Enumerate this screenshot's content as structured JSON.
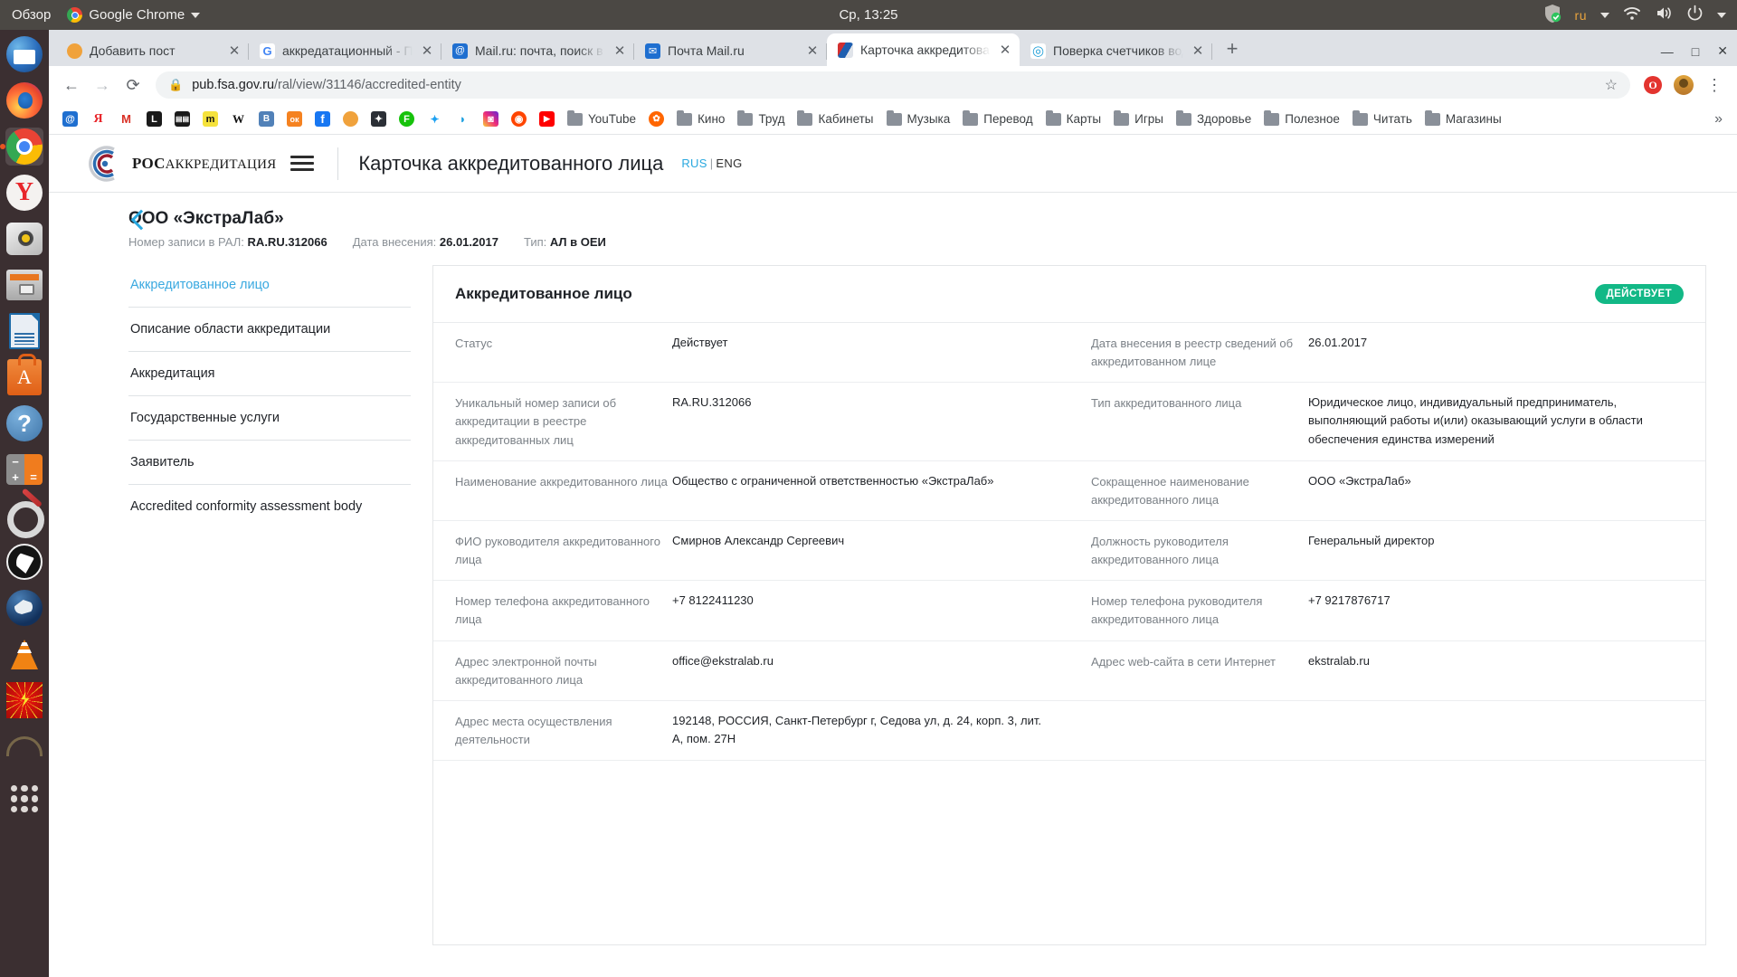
{
  "os_panel": {
    "activities": "Обзор",
    "app_menu": "Google Chrome",
    "clock": "Ср, 13:25",
    "tray": {
      "shield_icon": "shield-check-icon",
      "language": "ru",
      "wifi_icon": "wifi-icon",
      "volume_icon": "volume-icon",
      "power_icon": "power-icon"
    }
  },
  "dock": {
    "items": [
      {
        "name": "thunderbird",
        "label": "Thunderbird"
      },
      {
        "name": "firefox",
        "label": "Firefox"
      },
      {
        "name": "google-chrome",
        "label": "Google Chrome"
      },
      {
        "name": "yandex-browser",
        "label": "Yandex Browser"
      },
      {
        "name": "radiotray",
        "label": "Radio"
      },
      {
        "name": "files",
        "label": "Files"
      },
      {
        "name": "libreoffice",
        "label": "LibreOffice"
      },
      {
        "name": "ubuntu-software",
        "label": "Ubuntu Software"
      },
      {
        "name": "help",
        "label": "Help"
      },
      {
        "name": "calculator",
        "label": "Calculator"
      },
      {
        "name": "settings-tools",
        "label": "Tools"
      },
      {
        "name": "obs-studio",
        "label": "OBS Studio"
      },
      {
        "name": "steam",
        "label": "Steam"
      },
      {
        "name": "vlc",
        "label": "VLC"
      },
      {
        "name": "red-app",
        "label": "Game"
      },
      {
        "name": "arc-app",
        "label": "App"
      },
      {
        "name": "show-applications",
        "label": "Show Applications"
      }
    ]
  },
  "browser": {
    "tabs": [
      {
        "title": "Добавить пост",
        "favicon": "wordpress-icon",
        "color": "#f0a23c",
        "glyph": "",
        "active": false
      },
      {
        "title": "аккредатационный - Пои",
        "favicon": "google-icon",
        "color": "#ffffff",
        "glyph": "G",
        "active": false
      },
      {
        "title": "Mail.ru: почта, поиск в ин",
        "favicon": "mailru-icon",
        "color": "#1f6fd0",
        "glyph": "@",
        "active": false
      },
      {
        "title": "Почта Mail.ru",
        "favicon": "mail-icon",
        "color": "#1f6fd0",
        "glyph": "✉",
        "active": false
      },
      {
        "title": "Карточка аккредитованн",
        "favicon": "fsa-icon",
        "color": "#e0e4ea",
        "glyph": "",
        "active": true
      },
      {
        "title": "Поверка счетчиков воды",
        "favicon": "spiral-icon",
        "color": "#ffffff",
        "glyph": "◎",
        "active": false
      }
    ],
    "new_tab_label": "+",
    "window_controls": {
      "minimize": "—",
      "maximize": "□",
      "close": "✕"
    },
    "nav": {
      "back_icon": "arrow-left-icon",
      "forward_icon": "arrow-right-icon",
      "reload_icon": "reload-icon",
      "lock_icon": "lock-icon",
      "star_icon": "star-icon",
      "extension_icon": "opera-extension-icon",
      "avatar_icon": "user-avatar-icon"
    },
    "url": {
      "host": "pub.fsa.gov.ru",
      "path": "/ral/view/31146/accredited-entity"
    },
    "bookmarks": [
      {
        "label": "",
        "icon": "mailru-icon",
        "color": "#1f6fd0",
        "glyph": "@"
      },
      {
        "label": "",
        "icon": "yandex-icon",
        "color": "#ffffff",
        "glyph": "Я"
      },
      {
        "label": "",
        "icon": "gmail-icon",
        "color": "#ffffff",
        "glyph": "M"
      },
      {
        "label": "",
        "icon": "livejournal-icon",
        "color": "#1a1a1a",
        "glyph": "L"
      },
      {
        "label": "",
        "icon": "imdb-icon",
        "color": "#1a1a1a",
        "glyph": "▤"
      },
      {
        "label": "",
        "icon": "medium-icon",
        "color": "#f5e23c",
        "glyph": "m"
      },
      {
        "label": "",
        "icon": "wikipedia-icon",
        "color": "#ffffff",
        "glyph": "W"
      },
      {
        "label": "",
        "icon": "vk-icon",
        "color": "#5181b8",
        "glyph": "B"
      },
      {
        "label": "",
        "icon": "odnoklassniki-icon",
        "color": "#f58220",
        "glyph": "ок"
      },
      {
        "label": "",
        "icon": "facebook-icon",
        "color": "#1877f2",
        "glyph": "f"
      },
      {
        "label": "",
        "icon": "wordpress-icon",
        "color": "#f0a23c",
        "glyph": ""
      },
      {
        "label": "",
        "icon": "dark-star-icon",
        "color": "#2b2f36",
        "glyph": "✦"
      },
      {
        "label": "",
        "icon": "fastic-icon",
        "color": "#16c20b",
        "glyph": "F"
      },
      {
        "label": "",
        "icon": "twitter-icon",
        "color": "#ffffff",
        "glyph": "🐦"
      },
      {
        "label": "",
        "icon": "pocket-icon",
        "color": "#ffffff",
        "glyph": "◗"
      },
      {
        "label": "",
        "icon": "instagram-icon",
        "color": "#d62976",
        "glyph": "◙"
      },
      {
        "label": "",
        "icon": "reddit-icon",
        "color": "#ff4500",
        "glyph": "◉"
      },
      {
        "label": "",
        "icon": "youtube-icon",
        "color": "#ff0000",
        "glyph": "▶"
      },
      {
        "label": "YouTube",
        "icon": "folder-icon",
        "color": "",
        "glyph": ""
      },
      {
        "label": "",
        "icon": "kinopoisk-icon",
        "color": "#f60",
        "glyph": "✿"
      },
      {
        "label": "Кино",
        "icon": "folder-icon",
        "color": "",
        "glyph": ""
      },
      {
        "label": "Труд",
        "icon": "folder-icon",
        "color": "",
        "glyph": ""
      },
      {
        "label": "Кабинеты",
        "icon": "folder-icon",
        "color": "",
        "glyph": ""
      },
      {
        "label": "Музыка",
        "icon": "folder-icon",
        "color": "",
        "glyph": ""
      },
      {
        "label": "Перевод",
        "icon": "folder-icon",
        "color": "",
        "glyph": ""
      },
      {
        "label": "Карты",
        "icon": "folder-icon",
        "color": "",
        "glyph": ""
      },
      {
        "label": "Игры",
        "icon": "folder-icon",
        "color": "",
        "glyph": ""
      },
      {
        "label": "Здоровье",
        "icon": "folder-icon",
        "color": "",
        "glyph": ""
      },
      {
        "label": "Полезное",
        "icon": "folder-icon",
        "color": "",
        "glyph": ""
      },
      {
        "label": "Читать",
        "icon": "folder-icon",
        "color": "",
        "glyph": ""
      },
      {
        "label": "Магазины",
        "icon": "folder-icon",
        "color": "",
        "glyph": ""
      }
    ],
    "bookmarks_overflow": "»"
  },
  "site": {
    "logo_text_small": "РОС",
    "logo_text_main": "АККРЕДИТАЦИЯ",
    "menu_icon": "hamburger-menu-icon",
    "title": "Карточка аккредитованного лица",
    "lang_ru": "RUS",
    "lang_sep": "|",
    "lang_eng": "ENG"
  },
  "entity": {
    "back_icon": "back-chevron-icon",
    "name": "ООО «ЭкстраЛаб»",
    "meta": [
      {
        "label": "Номер записи в РАЛ:",
        "value": "RA.RU.312066"
      },
      {
        "label": "Дата внесения:",
        "value": "26.01.2017"
      },
      {
        "label": "Тип:",
        "value": "АЛ в ОЕИ"
      }
    ]
  },
  "side_nav": {
    "items": [
      {
        "label": "Аккредитованное лицо",
        "active": true
      },
      {
        "label": "Описание области аккредитации",
        "active": false
      },
      {
        "label": "Аккредитация",
        "active": false
      },
      {
        "label": "Государственные услуги",
        "active": false
      },
      {
        "label": "Заявитель",
        "active": false
      },
      {
        "label": "Accredited conformity assessment body",
        "active": false
      }
    ]
  },
  "card": {
    "title": "Аккредитованное лицо",
    "status_badge": "ДЕЙСТВУЕТ",
    "badge_color": "#12b886",
    "rows": [
      {
        "left": {
          "label": "Статус",
          "value": "Действует"
        },
        "right": {
          "label": "Дата внесения в реестр сведений об аккредитованном лице",
          "value": "26.01.2017"
        }
      },
      {
        "left": {
          "label": "Уникальный номер записи об аккредитации в реестре аккредитованных лиц",
          "value": "RA.RU.312066"
        },
        "right": {
          "label": "Тип аккредитованного лица",
          "value": "Юридическое лицо, индивидуальный предприниматель, выполняющий работы и(или) оказывающий услуги в области обеспечения единства измерений"
        }
      },
      {
        "left": {
          "label": "Наименование аккредитованного лица",
          "value": "Общество с ограниченной ответственностью «ЭкстраЛаб»"
        },
        "right": {
          "label": "Сокращенное наименование аккредитованного лица",
          "value": "ООО «ЭкстраЛаб»"
        }
      },
      {
        "left": {
          "label": "ФИО руководителя аккредитованного лица",
          "value": "Смирнов Александр Сергеевич"
        },
        "right": {
          "label": "Должность руководителя аккредитованного лица",
          "value": "Генеральный директор"
        }
      },
      {
        "left": {
          "label": "Номер телефона аккредитованного лица",
          "value": "+7 8122411230"
        },
        "right": {
          "label": "Номер телефона руководителя аккредитованного лица",
          "value": "+7 9217876717"
        }
      },
      {
        "left": {
          "label": "Адрес электронной почты аккредитованного лица",
          "value": "office@ekstralab.ru"
        },
        "right": {
          "label": "Адрес web-сайта в сети Интернет",
          "value": "ekstralab.ru"
        }
      },
      {
        "left": {
          "label": "Адрес места осуществления деятельности",
          "value": "192148, РОССИЯ, Санкт-Петербург г, Седова ул, д. 24, корп. 3, лит. А, пом. 27Н"
        },
        "right": {
          "label": "",
          "value": ""
        }
      }
    ]
  }
}
